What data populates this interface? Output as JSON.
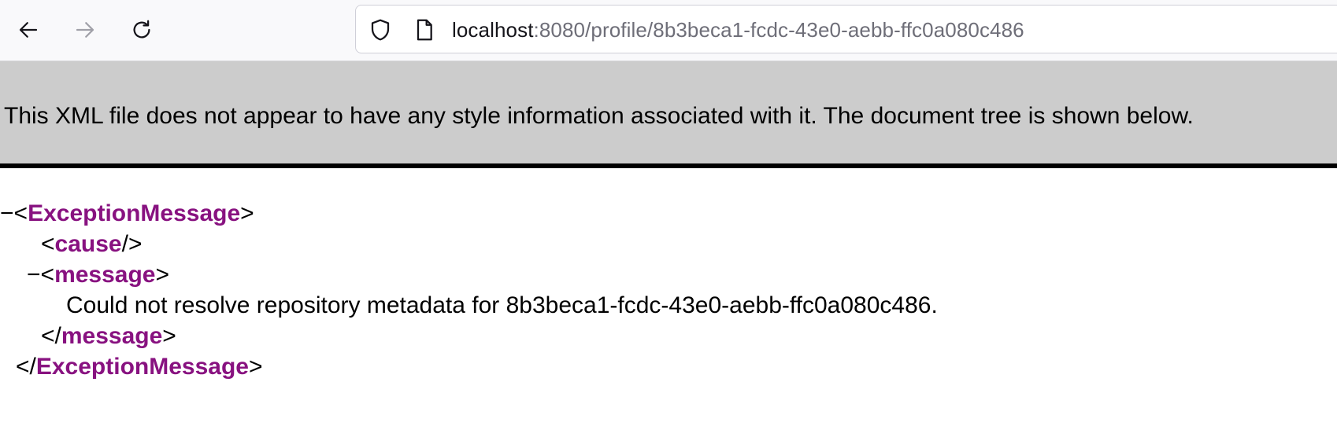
{
  "browser": {
    "url_host": "localhost",
    "url_rest": ":8080/profile/8b3beca1-fcdc-43e0-aebb-ffc0a080c486",
    "icons": {
      "back": "arrow-left-icon",
      "forward": "arrow-right-icon",
      "reload": "reload-icon",
      "security": "shield-icon",
      "page": "page-icon"
    }
  },
  "xml_viewer": {
    "banner": "This XML file does not appear to have any style information associated with it. The document tree is shown below.",
    "collapse_marker": "−",
    "tree": {
      "root_tag": "ExceptionMessage",
      "cause_tag": "cause",
      "message_tag": "message",
      "message_text": "Could not resolve repository metadata for 8b3beca1-fcdc-43e0-aebb-ffc0a080c486."
    }
  },
  "colors": {
    "tag_name": "#881280",
    "banner_bg": "#cccccc",
    "toolbar_bg": "#f9f9fb"
  }
}
